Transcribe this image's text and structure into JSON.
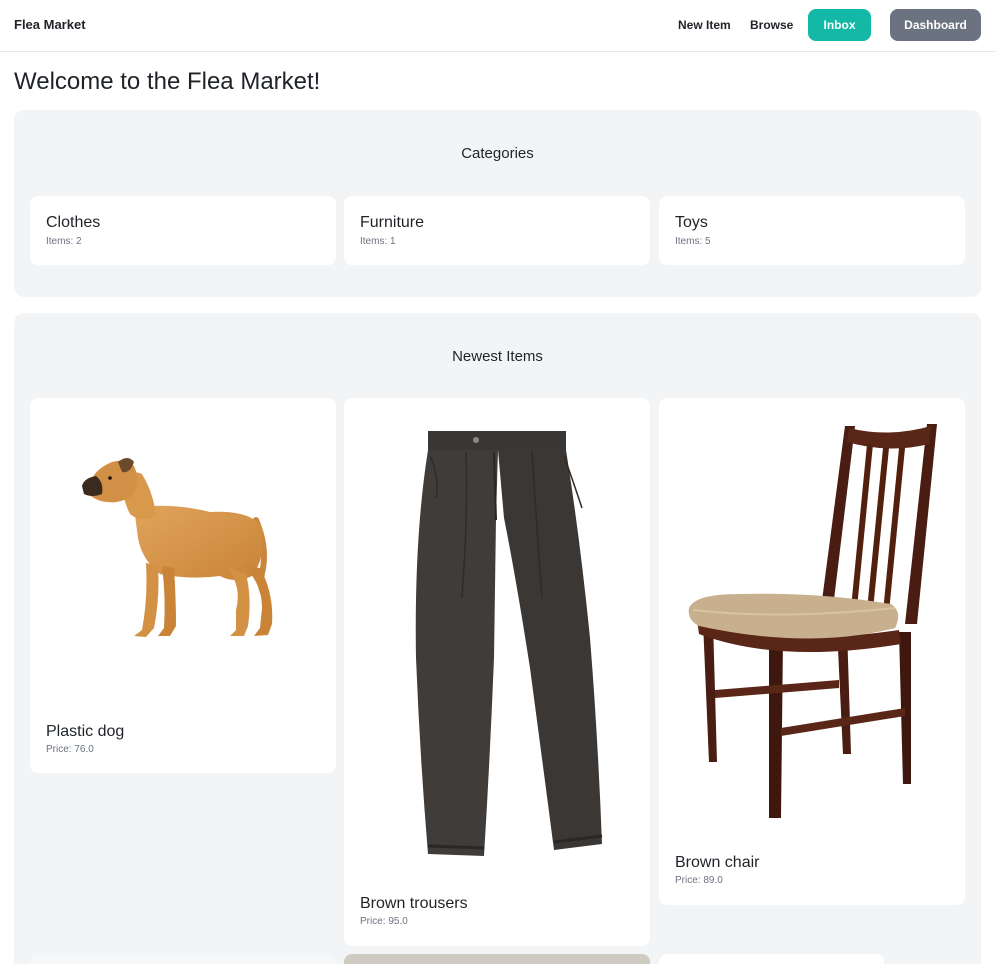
{
  "nav": {
    "brand": "Flea Market",
    "new_item": "New Item",
    "browse": "Browse",
    "inbox": "Inbox",
    "dashboard": "Dashboard"
  },
  "page_title": "Welcome to the Flea Market!",
  "categories": {
    "title": "Categories",
    "items": [
      {
        "name": "Clothes",
        "count": "Items: 2"
      },
      {
        "name": "Furniture",
        "count": "Items: 1"
      },
      {
        "name": "Toys",
        "count": "Items: 5"
      }
    ]
  },
  "newest": {
    "title": "Newest Items",
    "items": [
      {
        "name": "Plastic dog",
        "price": "Price: 76.0"
      },
      {
        "name": "Brown trousers",
        "price": "Price: 95.0"
      },
      {
        "name": "Brown chair",
        "price": "Price: 89.0"
      }
    ]
  },
  "colors": {
    "inbox": "#14b8a6",
    "dashboard": "#6b7280",
    "panel": "#f3f4f6"
  }
}
